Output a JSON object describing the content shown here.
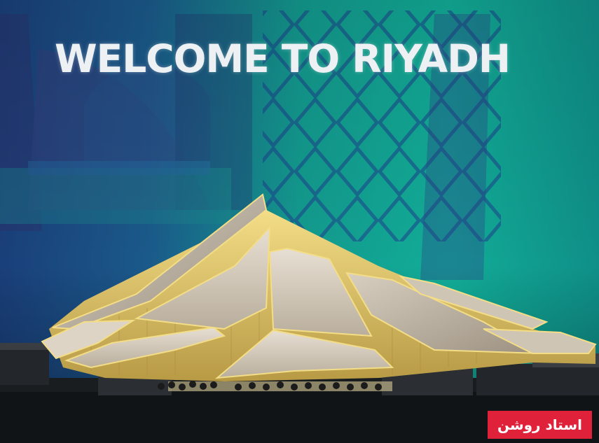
{
  "photo": {
    "screen_text": "WELCOME TO RIYADH",
    "caption": "استاد روشن",
    "colors": {
      "screen_teal": "#14b39a",
      "screen_blue": "#1a4fa0",
      "model_light": "#f0d878",
      "caption_red": "#e0213a"
    }
  }
}
